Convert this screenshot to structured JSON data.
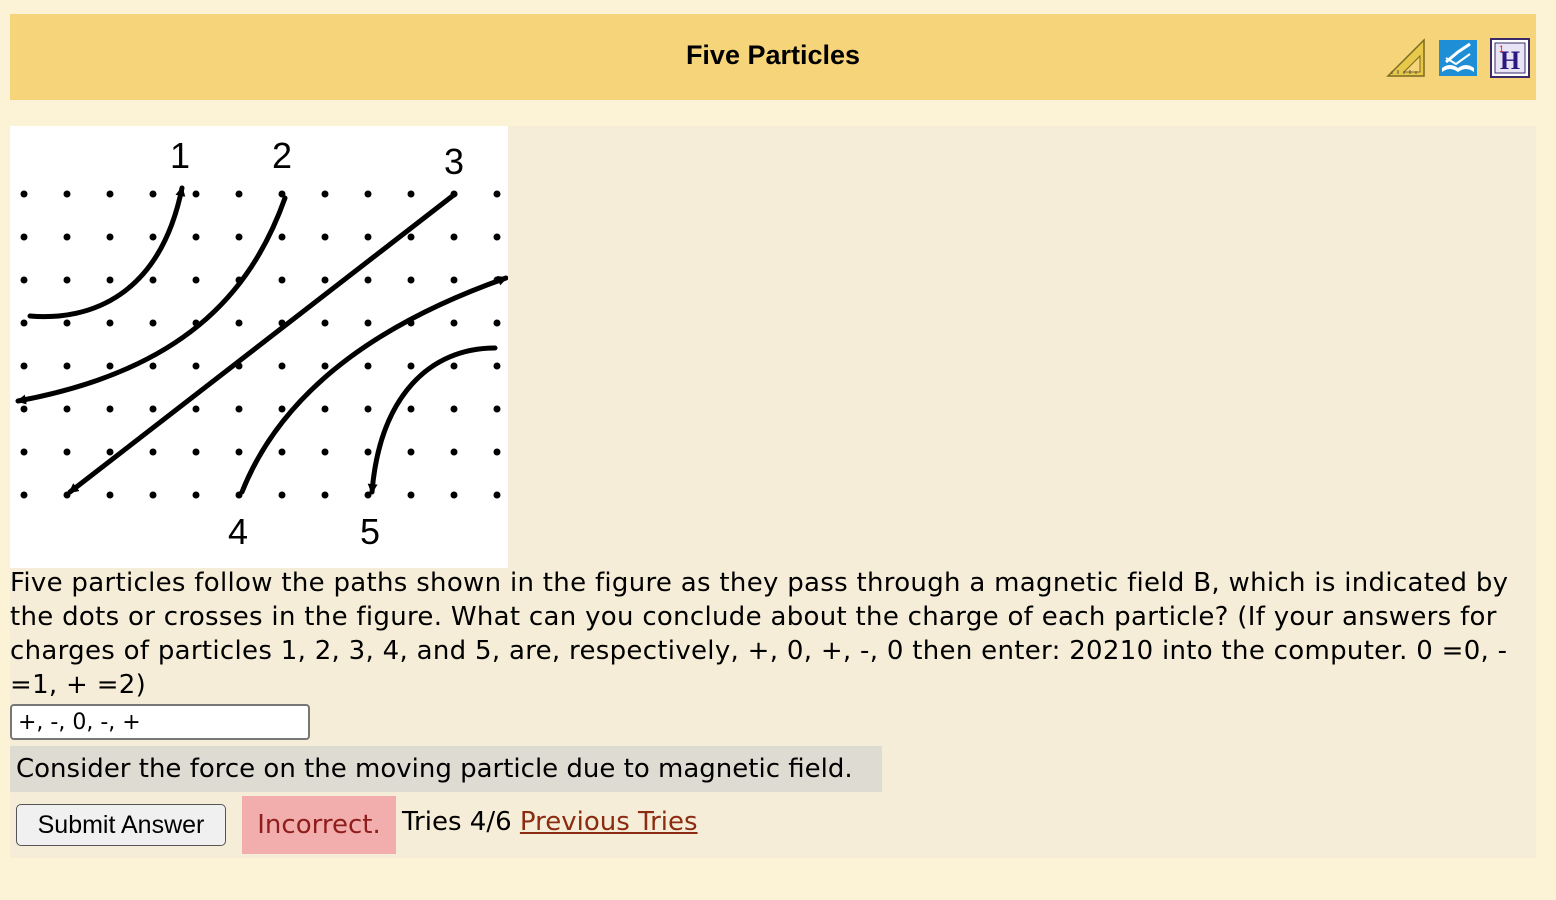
{
  "header": {
    "title": "Five Particles",
    "icons": [
      "triangle-ruler-icon",
      "book-icon",
      "hint-h-icon"
    ]
  },
  "figure": {
    "particle_labels": [
      "1",
      "2",
      "3",
      "4",
      "5"
    ],
    "field_symbol": "dots"
  },
  "question": {
    "text": "Five particles follow the paths shown in the figure as they pass through a magnetic field B, which is indicated by the dots or crosses in the figure. What can you conclude about the charge of each particle? (If your answers for charges of particles 1, 2, 3, 4, and 5, are, respectively, +, 0, +, -, 0 then enter: 20210 into the computer. 0 =0, - =1, + =2)"
  },
  "answer": {
    "value": "+, -, 0, -, +"
  },
  "hint": {
    "text": "Consider the force on the moving particle due to magnetic field."
  },
  "actions": {
    "submit_label": "Submit Answer",
    "status": "Incorrect.",
    "tries": "Tries 4/6",
    "previous_tries_label": "Previous Tries"
  },
  "colors": {
    "page_bg": "#fcf3d7",
    "header_bg": "#f6d57a",
    "panel_bg": "#f5edd7",
    "hint_bg": "#dedbd3",
    "incorrect_bg": "#f1aeac",
    "incorrect_text": "#8f1d1b",
    "link": "#8b2c12"
  }
}
